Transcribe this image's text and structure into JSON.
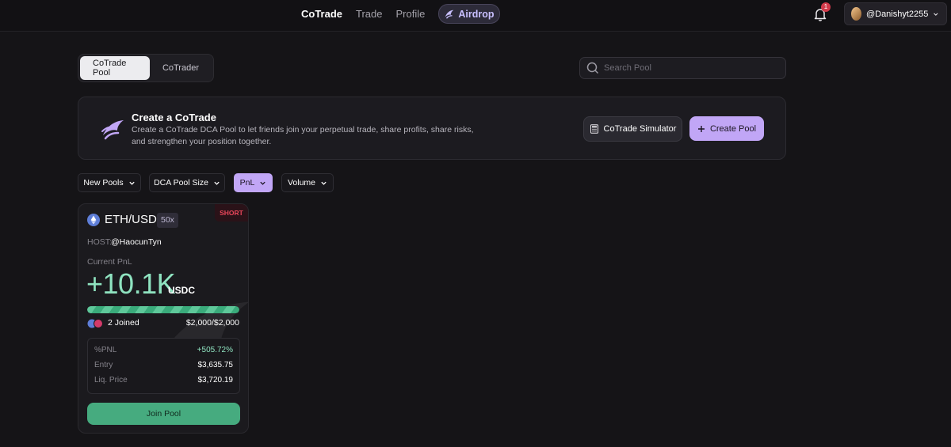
{
  "nav": {
    "items": [
      "CoTrade",
      "Trade",
      "Profile"
    ],
    "airdrop": "Airdrop"
  },
  "notifications": {
    "count": "1"
  },
  "user": {
    "handle": "@Danishyt2255"
  },
  "tabs": [
    "CoTrade Pool",
    "CoTrader"
  ],
  "search": {
    "placeholder": "Search Pool"
  },
  "banner": {
    "title": "Create a CoTrade",
    "description": "Create a CoTrade DCA Pool to let friends join your perpetual trade, share profits, share risks, and strengthen your position together.",
    "simulator_label": "CoTrade Simulator",
    "create_label": "Create Pool"
  },
  "filters": [
    "New Pools",
    "DCA Pool Size",
    "PnL",
    "Volume"
  ],
  "pool": {
    "side": "SHORT",
    "pair": "ETH/USD",
    "leverage": "50x",
    "host_label": "HOST:",
    "host": "@HaocunTyn",
    "pnl_label": "Current PnL",
    "pnl_value": "+10.1K",
    "pnl_unit": "USDC",
    "progress_pct": 100,
    "joined": "2 Joined",
    "amount": "$2,000/$2,000",
    "stats": [
      {
        "label": "%PNL",
        "value": "+505.72%"
      },
      {
        "label": "Entry",
        "value": "$3,635.75"
      },
      {
        "label": "Liq. Price",
        "value": "$3,720.19"
      }
    ],
    "join_label": "Join Pool"
  },
  "colors": {
    "accent": "#c1a6f6",
    "profit": "#8fe3c0",
    "short": "#e9465a",
    "join": "#46ab7f"
  }
}
